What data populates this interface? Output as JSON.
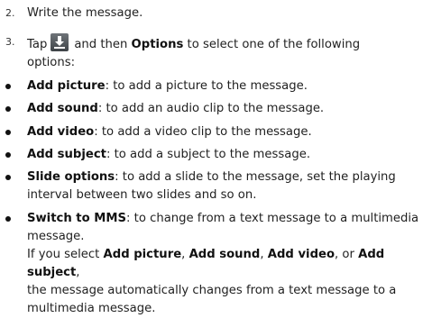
{
  "step2": {
    "number": "2.",
    "text": "Write the message."
  },
  "step3": {
    "number": "3.",
    "tap": "Tap",
    "and_then": "and then",
    "options_label": "Options",
    "rest": "to select one of the following",
    "line2": "options:",
    "icon": "download-arrow-icon"
  },
  "bullets": [
    {
      "term": "Add picture",
      "desc": ": to add a picture to the message."
    },
    {
      "term": "Add sound",
      "desc": ": to add an audio clip to the message."
    },
    {
      "term": "Add video",
      "desc": ": to add a video clip to the message."
    },
    {
      "term": "Add subject",
      "desc": ": to add a subject to the message."
    },
    {
      "term": "Slide options",
      "desc": ": to add a slide to the message, set the playing",
      "line2": "interval between two slides and so on."
    },
    {
      "term": "Switch to MMS",
      "desc": ": to change from a text message to a multimedia",
      "line2": "message."
    }
  ],
  "note": {
    "if_you_select": "If you select",
    "t1": "Add picture",
    "sep1": ",",
    "t2": "Add sound",
    "sep2": ",",
    "t3": "Add video",
    "sep3": ", or",
    "t4": "Add subject",
    "sep4": ",",
    "line2": "the message automatically changes from a text message to a",
    "line3": "multimedia message."
  }
}
